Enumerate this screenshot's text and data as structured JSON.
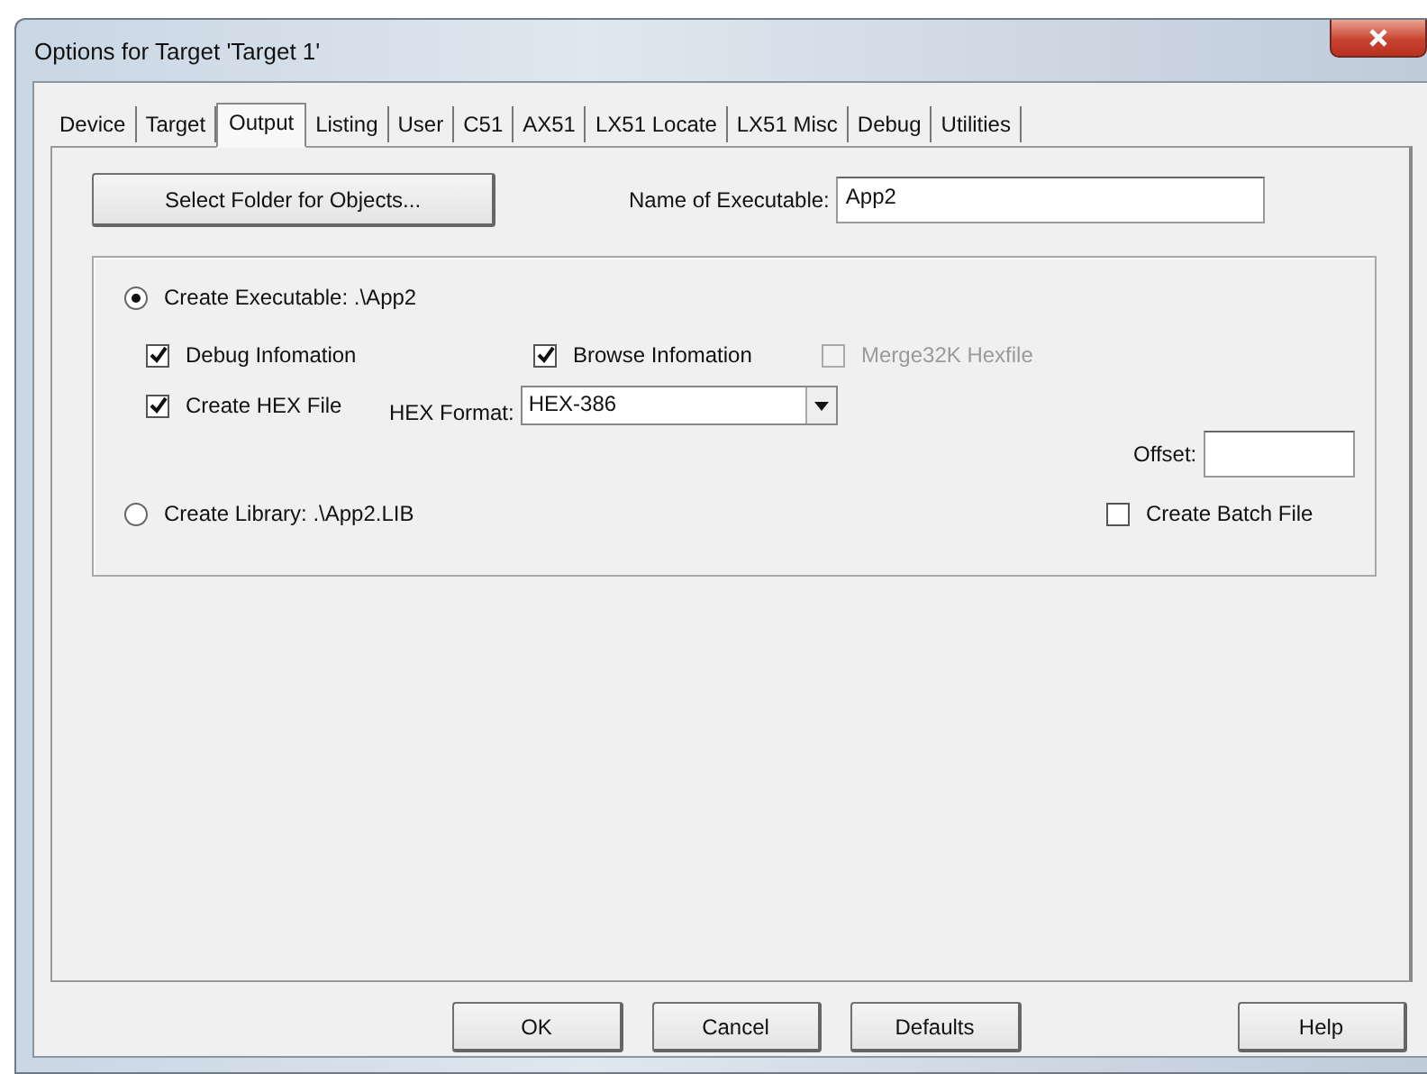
{
  "window": {
    "title": "Options for Target 'Target 1'"
  },
  "tabs": [
    {
      "label": "Device",
      "selected": false
    },
    {
      "label": "Target",
      "selected": false
    },
    {
      "label": "Output",
      "selected": true
    },
    {
      "label": "Listing",
      "selected": false
    },
    {
      "label": "User",
      "selected": false
    },
    {
      "label": "C51",
      "selected": false
    },
    {
      "label": "AX51",
      "selected": false
    },
    {
      "label": "LX51 Locate",
      "selected": false
    },
    {
      "label": "LX51 Misc",
      "selected": false
    },
    {
      "label": "Debug",
      "selected": false
    },
    {
      "label": "Utilities",
      "selected": false
    }
  ],
  "select_folder_button": "Select Folder for Objects...",
  "name_of_executable": {
    "label": "Name of Executable:",
    "value": "App2"
  },
  "create_executable": {
    "label": "Create Executable:  .\\App2",
    "selected": true
  },
  "debug_information": {
    "label": "Debug Infomation",
    "checked": true,
    "disabled": false
  },
  "browse_information": {
    "label": "Browse Infomation",
    "checked": true,
    "disabled": false
  },
  "merge32k_hexfile": {
    "label": "Merge32K Hexfile",
    "checked": false,
    "disabled": true
  },
  "create_hex_file": {
    "label": "Create HEX File",
    "checked": true,
    "disabled": false
  },
  "hex_format": {
    "label": "HEX Format:",
    "value": "HEX-386"
  },
  "offset": {
    "label": "Offset:"
  },
  "create_library": {
    "label": "Create Library:  .\\App2.LIB",
    "selected": false
  },
  "create_batch_file": {
    "label": "Create Batch File",
    "checked": false,
    "disabled": false
  },
  "buttons": [
    "OK",
    "Cancel",
    "Defaults",
    "Help"
  ]
}
